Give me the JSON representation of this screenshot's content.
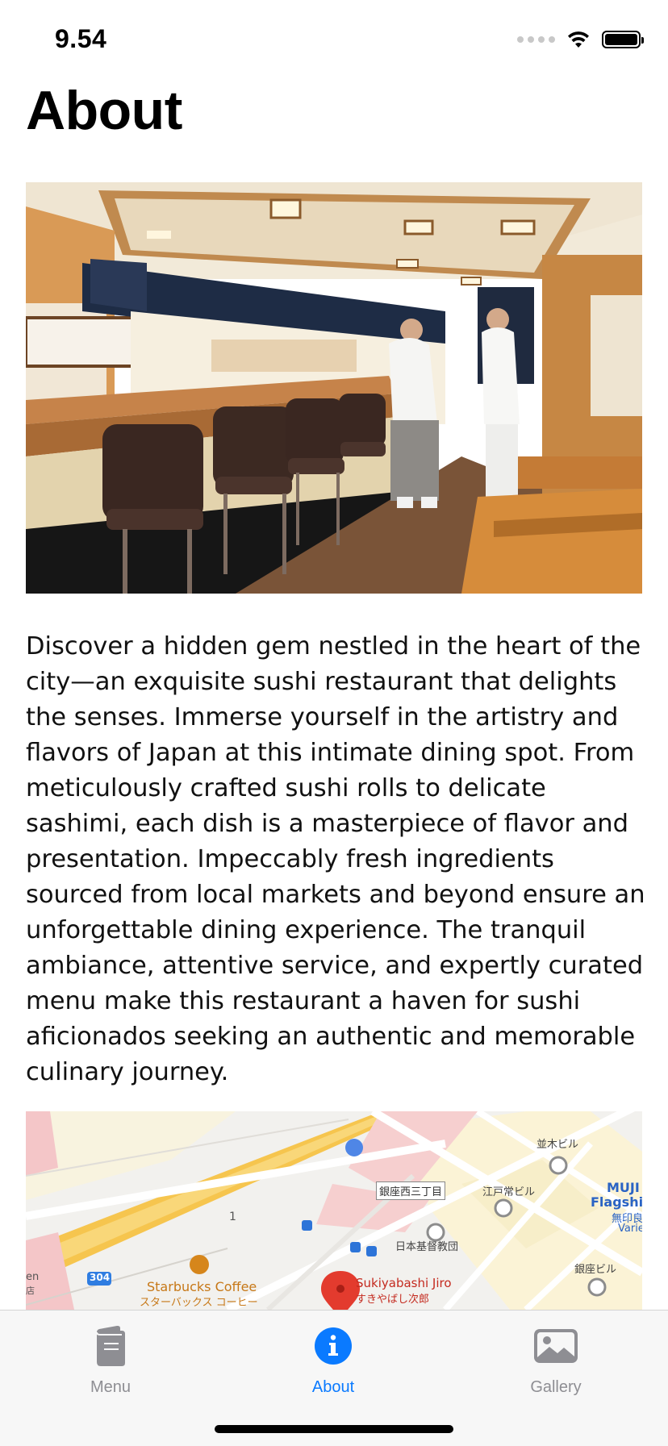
{
  "status_bar": {
    "time": "9.54"
  },
  "page": {
    "title": "About"
  },
  "about": {
    "description": "Discover a hidden gem nestled in the heart of the city—an exquisite sushi restaurant that delights the senses. Immerse yourself in the artistry and flavors of Japan at this intimate dining spot. From meticulously crafted sushi rolls to delicate sashimi, each dish is a masterpiece of flavor and presentation. Impeccably fresh ingredients sourced from local markets and beyond ensure an unforgettable dining experience. The tranquil ambiance, attentive service, and expertly curated menu make this restaurant a haven for sushi aficionados seeking an authentic and memorable culinary journey."
  },
  "map": {
    "labels": {
      "namiki_bldg": "並木ビル",
      "ginza_nishi": "銀座西三丁目",
      "edojo_bldg": "江戸常ビル",
      "muji_1": "MUJI",
      "muji_2": "Flagship",
      "muji_3": "無印良",
      "muji_4": "Varie",
      "nihon_kiin": "日本基督教団",
      "ginza_bldg": "銀座ビル",
      "starbucks_en": "Starbucks Coffee",
      "starbucks_jp": "スターバックス コーヒー",
      "sukiyabashi_en": "Sukiyabashi Jiro",
      "sukiyabashi_jp": "すきやばし次郎",
      "route": "304",
      "left_en": "en",
      "left_jp": "店",
      "marker_1": "1"
    }
  },
  "tab_bar": {
    "tabs": [
      {
        "label": "Menu",
        "icon": "book-icon",
        "selected": false
      },
      {
        "label": "About",
        "icon": "info-icon",
        "selected": true
      },
      {
        "label": "Gallery",
        "icon": "photo-icon",
        "selected": false
      }
    ]
  },
  "colors": {
    "accent": "#0a7aff",
    "inactive": "#8e8e93",
    "map_road": "#f6c54e",
    "pin": "#e33b2e",
    "starbucks": "#d6861b"
  }
}
